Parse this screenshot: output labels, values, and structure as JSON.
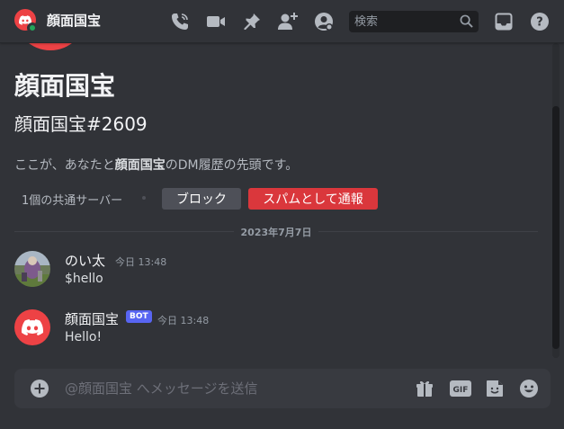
{
  "header": {
    "title": "顔面国宝",
    "icons": [
      "phone-call-icon",
      "video-camera-icon",
      "pin-icon",
      "add-friend-icon",
      "profile-icon",
      "inbox-icon",
      "help-icon"
    ],
    "search": {
      "placeholder": "検索"
    }
  },
  "intro": {
    "display_name": "顔面国宝",
    "username": "顔面国宝#2609",
    "desc_prefix": "ここが、あなたと",
    "desc_name": "顔面国宝",
    "desc_suffix": "のDM履歴の先頭です。",
    "mutual_servers": "1個の共通サーバー",
    "block_label": "ブロック",
    "report_label": "スパムとして通報"
  },
  "divider": {
    "date": "2023年7月7日"
  },
  "messages": [
    {
      "author": "のい太",
      "time": "今日 13:48",
      "text": "$hello",
      "bot": false
    },
    {
      "author": "顔面国宝",
      "badge": "BOT",
      "time": "今日 13:48",
      "text": "Hello!",
      "bot": true
    }
  ],
  "composer": {
    "placeholder": "@顔面国宝 へメッセージを送信",
    "icons": [
      "add-attachment-icon",
      "gift-icon",
      "gif-icon",
      "sticker-icon",
      "emoji-icon"
    ]
  },
  "colors": {
    "background": "#313338",
    "brand_red": "#ed4245",
    "report_red": "#da373c",
    "blurple": "#5865f2",
    "online": "#23a55a"
  }
}
